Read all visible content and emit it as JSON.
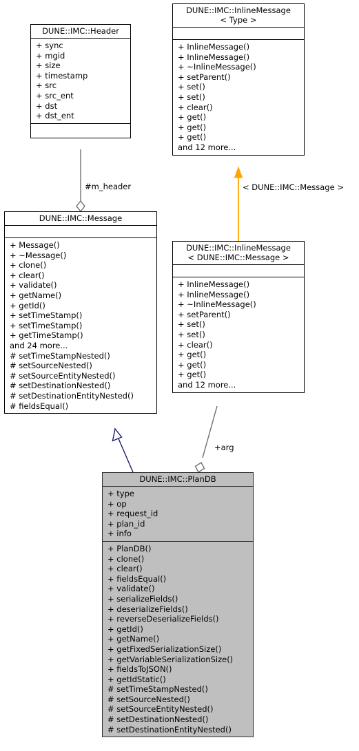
{
  "diagram": {
    "type": "uml-class-diagram",
    "title": "DUNE::IMC::PlanDB class hierarchy",
    "colors": {
      "box_fill": "#ffffff",
      "highlight_fill": "#bfbfbf",
      "border": "#000000",
      "inheritance_edge": "#191970",
      "aggregation_edge": "#707070",
      "template_edge": "#ffa500"
    }
  },
  "classes": {
    "header": {
      "name": "DUNE::IMC::Header",
      "attributes": [
        "+ sync",
        "+ mgid",
        "+ size",
        "+ timestamp",
        "+ src",
        "+ src_ent",
        "+ dst",
        "+ dst_ent"
      ],
      "operations": []
    },
    "inline_message_type": {
      "name": "DUNE::IMC::InlineMessage\n< Type >",
      "attributes": [],
      "operations": [
        "+ InlineMessage()",
        "+ InlineMessage()",
        "+ ~InlineMessage()",
        "+ setParent()",
        "+ set()",
        "+ set()",
        "+ clear()",
        "+ get()",
        "+ get()",
        "+ get()",
        "and 12 more..."
      ]
    },
    "message": {
      "name": "DUNE::IMC::Message",
      "attributes": [],
      "operations": [
        "+ Message()",
        "+ ~Message()",
        "+ clone()",
        "+ clear()",
        "+ validate()",
        "+ getName()",
        "+ getId()",
        "+ setTimeStamp()",
        "+ setTimeStamp()",
        "+ getTimeStamp()",
        "and 24 more...",
        "# setTimeStampNested()",
        "# setSourceNested()",
        "# setSourceEntityNested()",
        "# setDestinationNested()",
        "# setDestinationEntityNested()",
        "# fieldsEqual()"
      ]
    },
    "inline_message_message": {
      "name": "DUNE::IMC::InlineMessage\n< DUNE::IMC::Message >",
      "attributes": [],
      "operations": [
        "+ InlineMessage()",
        "+ InlineMessage()",
        "+ ~InlineMessage()",
        "+ setParent()",
        "+ set()",
        "+ set()",
        "+ clear()",
        "+ get()",
        "+ get()",
        "+ get()",
        "and 12 more..."
      ]
    },
    "plandb": {
      "name": "DUNE::IMC::PlanDB",
      "attributes": [
        "+ type",
        "+ op",
        "+ request_id",
        "+ plan_id",
        "+ info"
      ],
      "operations": [
        "+ PlanDB()",
        "+ clone()",
        "+ clear()",
        "+ fieldsEqual()",
        "+ validate()",
        "+ serializeFields()",
        "+ deserializeFields()",
        "+ reverseDeserializeFields()",
        "+ getId()",
        "+ getName()",
        "+ getFixedSerializationSize()",
        "+ getVariableSerializationSize()",
        "+ fieldsToJSON()",
        "+ getIdStatic()",
        "# setTimeStampNested()",
        "# setSourceNested()",
        "# setSourceEntityNested()",
        "# setDestinationNested()",
        "# setDestinationEntityNested()"
      ]
    }
  },
  "edges": {
    "header_to_message": {
      "label": "#m_header",
      "kind": "aggregation"
    },
    "template_binding": {
      "label": "< DUNE::IMC::Message >",
      "kind": "template-instantiation"
    },
    "inline_to_plandb": {
      "label": "+arg",
      "kind": "aggregation"
    },
    "message_to_plandb": {
      "label": "",
      "kind": "inheritance"
    }
  }
}
